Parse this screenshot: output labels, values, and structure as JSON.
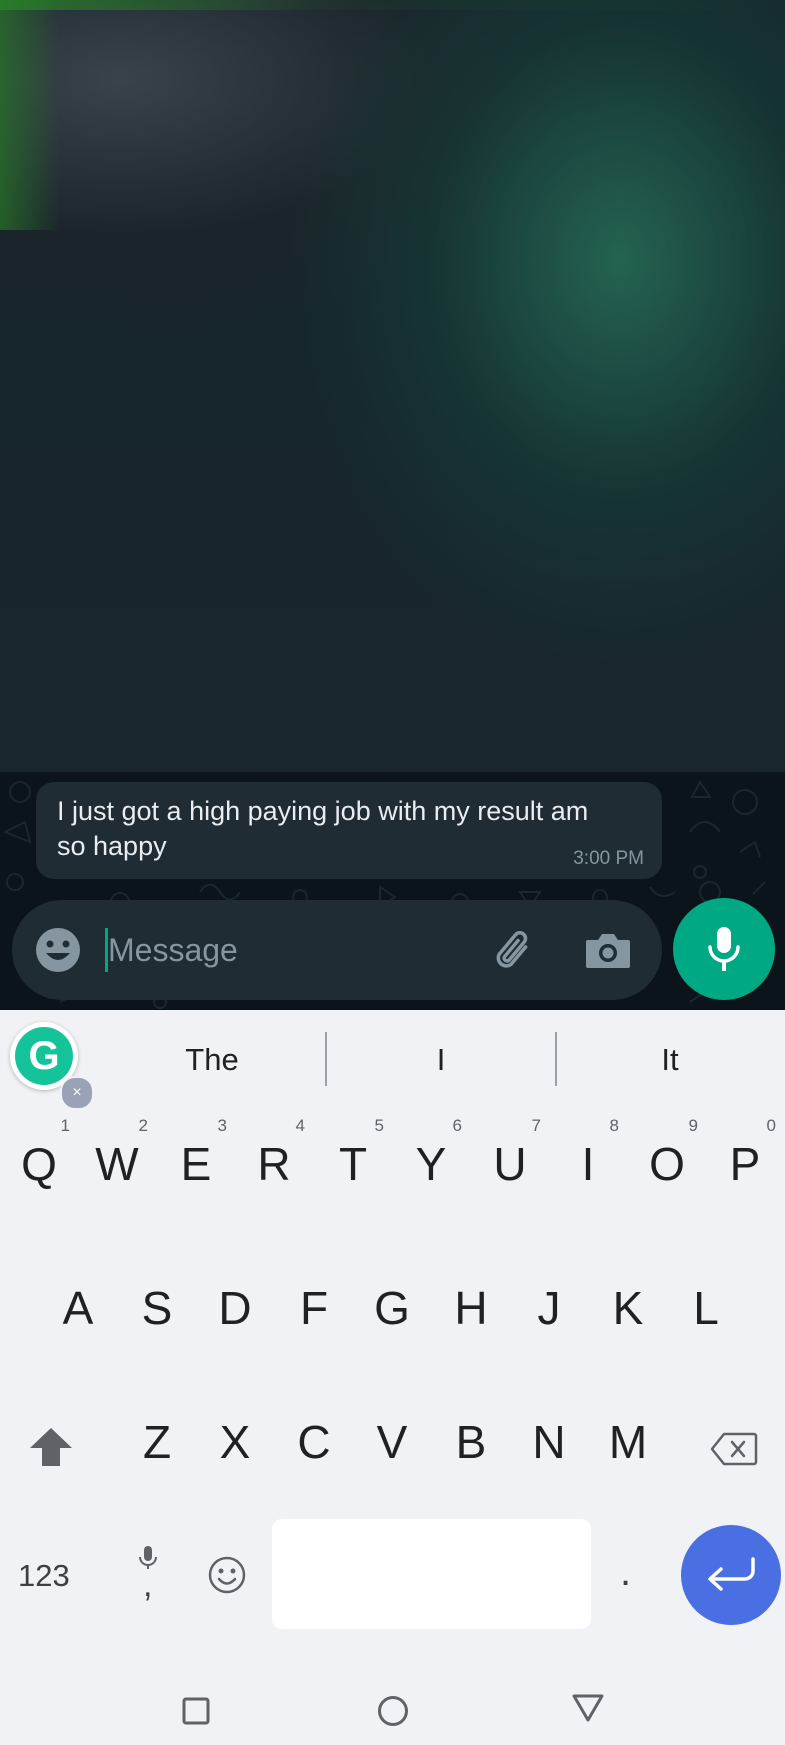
{
  "chat": {
    "message": {
      "text": "I just got a high paying job with my result am so happy",
      "time": "3:00 PM"
    },
    "composer": {
      "placeholder": "Message",
      "icons": [
        "emoji-icon",
        "paperclip-icon",
        "camera-icon",
        "microphone-icon"
      ]
    }
  },
  "keyboard": {
    "suggestions": [
      "The",
      "I",
      "It"
    ],
    "row1": [
      {
        "key": "Q",
        "hint": "1"
      },
      {
        "key": "W",
        "hint": "2"
      },
      {
        "key": "E",
        "hint": "3"
      },
      {
        "key": "R",
        "hint": "4"
      },
      {
        "key": "T",
        "hint": "5"
      },
      {
        "key": "Y",
        "hint": "6"
      },
      {
        "key": "U",
        "hint": "7"
      },
      {
        "key": "I",
        "hint": "8"
      },
      {
        "key": "O",
        "hint": "9"
      },
      {
        "key": "P",
        "hint": "0"
      }
    ],
    "row2": [
      "A",
      "S",
      "D",
      "F",
      "G",
      "H",
      "J",
      "K",
      "L"
    ],
    "row3": [
      "Z",
      "X",
      "C",
      "V",
      "B",
      "N",
      "M"
    ],
    "bottom": {
      "numbers_label": "123",
      "comma_label": ",",
      "period_label": "."
    },
    "grammarly_letter": "G",
    "colors": {
      "accent": "#00a884",
      "enter": "#4a6fe3",
      "grammarly": "#15c39a"
    }
  },
  "navbar": {
    "icons": [
      "recents-square-icon",
      "home-circle-icon",
      "back-triangle-icon"
    ]
  }
}
